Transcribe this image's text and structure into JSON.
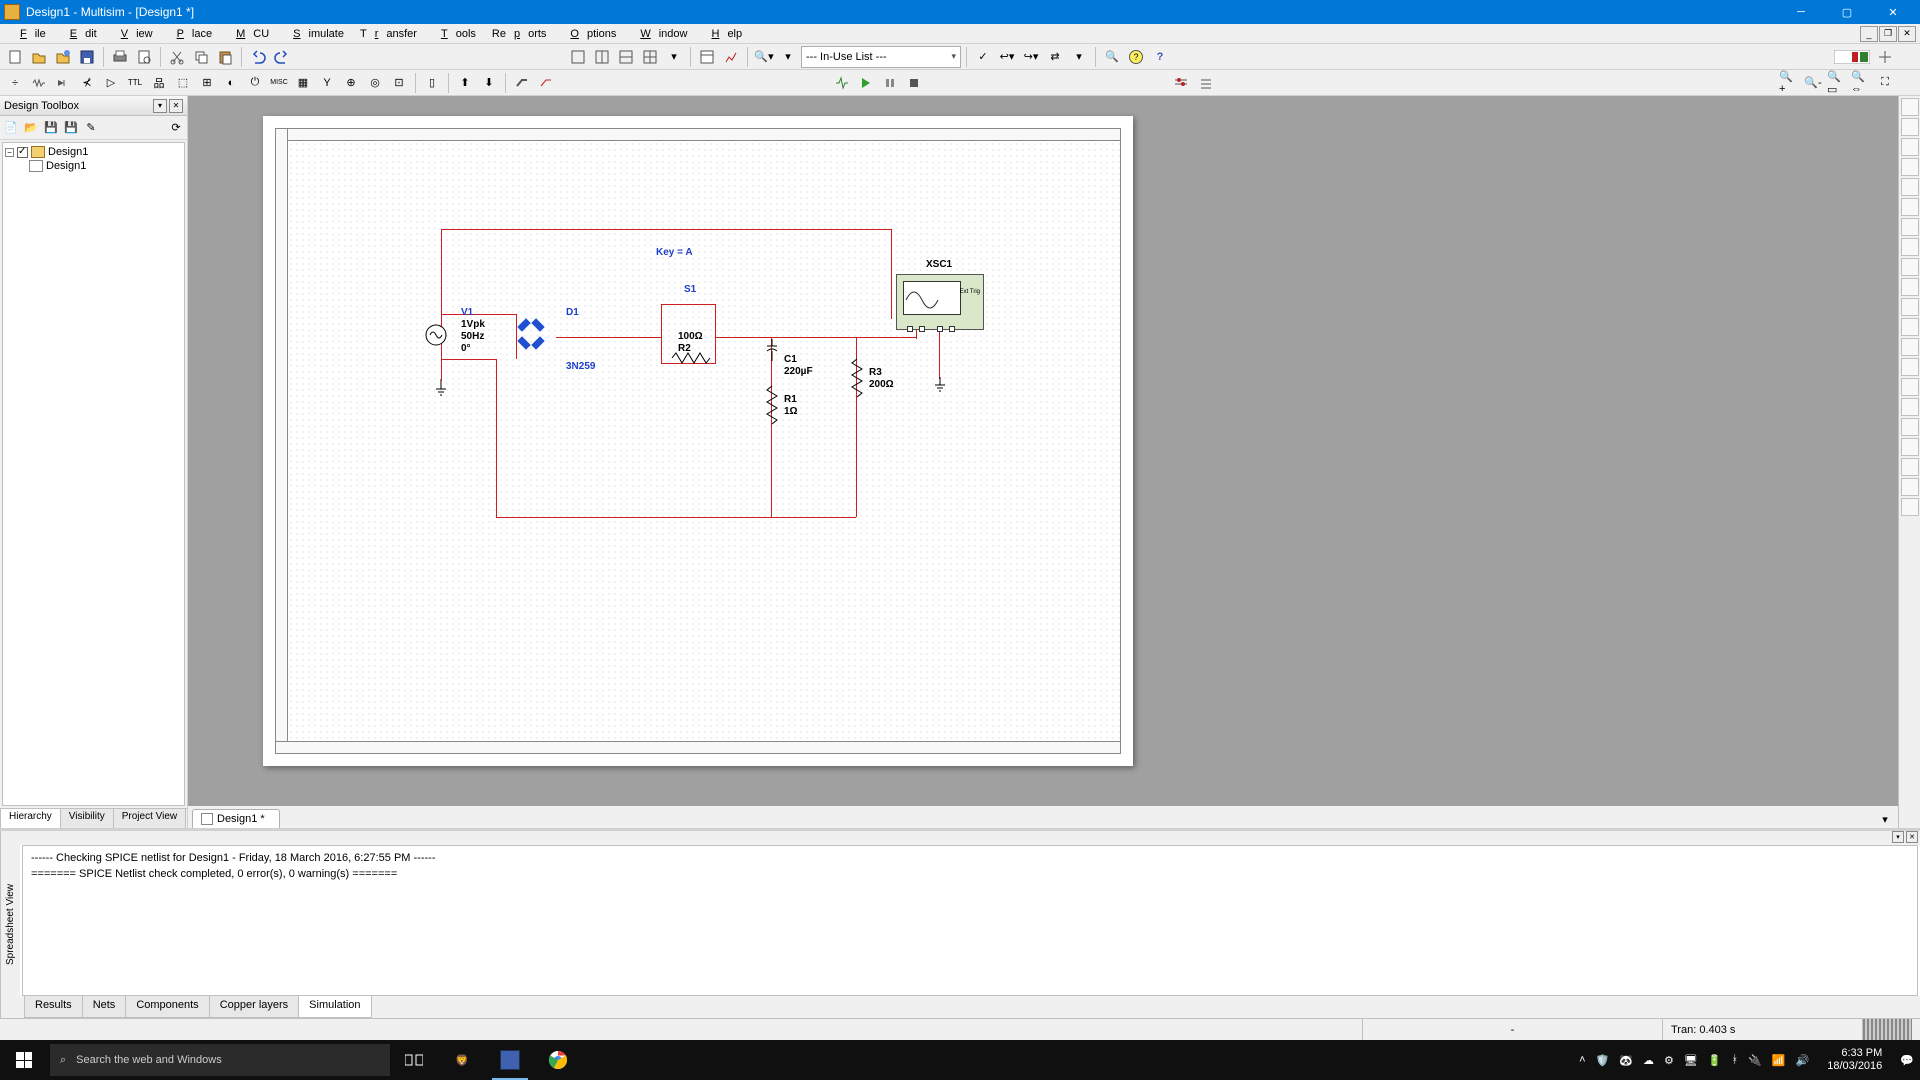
{
  "app": {
    "title": "Design1 - Multisim - [Design1 *]"
  },
  "menu": [
    "File",
    "Edit",
    "View",
    "Place",
    "MCU",
    "Simulate",
    "Transfer",
    "Tools",
    "Reports",
    "Options",
    "Window",
    "Help"
  ],
  "inuse": "--- In-Use List ---",
  "palette": {
    "title": "Design Toolbox",
    "root": "Design1",
    "child": "Design1",
    "tabs": [
      "Hierarchy",
      "Visibility",
      "Project View"
    ]
  },
  "circuit": {
    "key": "Key = A",
    "S1": "S1",
    "D1": "D1",
    "V1": "V1",
    "V1a": "1Vpk",
    "V1b": "50Hz",
    "V1c": "0°",
    "R2a": "100Ω",
    "R2b": "R2",
    "D1v": "3N259",
    "C1": "C1",
    "C1v": "220µF",
    "R1": "R1",
    "R1v": "1Ω",
    "R3": "R3",
    "R3v": "200Ω",
    "XSC1": "XSC1",
    "scopeext": "Ext Trig"
  },
  "doctab": "Design1 *",
  "output": {
    "sidetab": "Spreadsheet View",
    "line1": "------ Checking SPICE netlist for Design1 - Friday, 18 March 2016, 6:27:55 PM ------",
    "line2": "======= SPICE Netlist check completed, 0 error(s), 0 warning(s) =======",
    "tabs": [
      "Results",
      "Nets",
      "Components",
      "Copper layers",
      "Simulation"
    ]
  },
  "status": {
    "dash": "-",
    "tran": "Tran: 0.403 s"
  },
  "taskbar": {
    "search": "Search the web and Windows",
    "time": "6:33 PM",
    "date": "18/03/2016"
  }
}
